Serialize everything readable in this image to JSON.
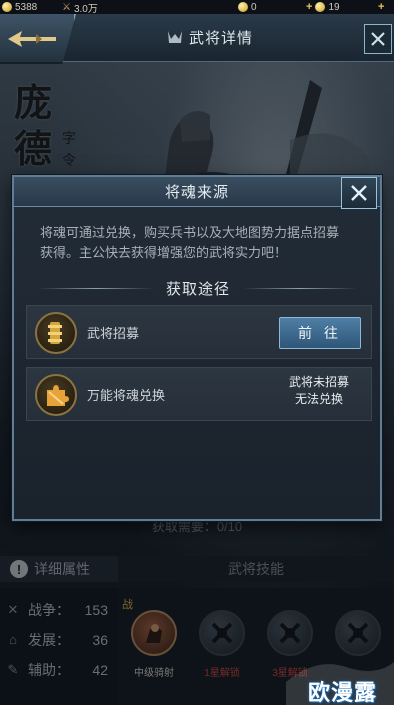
{
  "topbar": {
    "gold": "5388",
    "power": "3.0万",
    "coins": "0",
    "ingots": "19"
  },
  "header": {
    "title": "武将详情"
  },
  "hero": {
    "name": "庞德",
    "courtesy": "字令"
  },
  "dialog": {
    "title": "将魂来源",
    "description_line1": "将魂可通过兑换，购买兵书以及大地图势力据点招募",
    "description_line2": "获得。主公快去获得增强您的武将实力吧！",
    "routes_title": "获取途径",
    "routes": [
      {
        "name": "武将招募",
        "action": "前 往",
        "icon": "scroll-icon"
      },
      {
        "name": "万能将魂兑换",
        "status_line1": "武将未招募",
        "status_line2": "无法兑换",
        "icon": "soul-puzzle-icon"
      }
    ]
  },
  "background": {
    "need_text": "获取需要：0/10",
    "tab_attributes": "详细属性",
    "tab_skills": "武将技能",
    "stats": [
      {
        "label": "战争：",
        "value": "153",
        "icon": "crossed-swords-icon"
      },
      {
        "label": "发展：",
        "value": "36",
        "icon": "castle-icon"
      },
      {
        "label": "辅助：",
        "value": "42",
        "icon": "helper-icon"
      }
    ],
    "skills": [
      {
        "label": "中级骑射",
        "locked": false
      },
      {
        "label": "1星解锁",
        "locked": true
      },
      {
        "label": "3星解锁",
        "locked": true
      },
      {
        "label": "",
        "locked": true
      }
    ],
    "skill_tag": "战"
  },
  "watermark": "欧漫露",
  "colors": {
    "accent_blue": "#4f7fa6",
    "border_blue": "#5d7e96",
    "gold": "#e8c45a",
    "locked_red": "#d2463b"
  }
}
